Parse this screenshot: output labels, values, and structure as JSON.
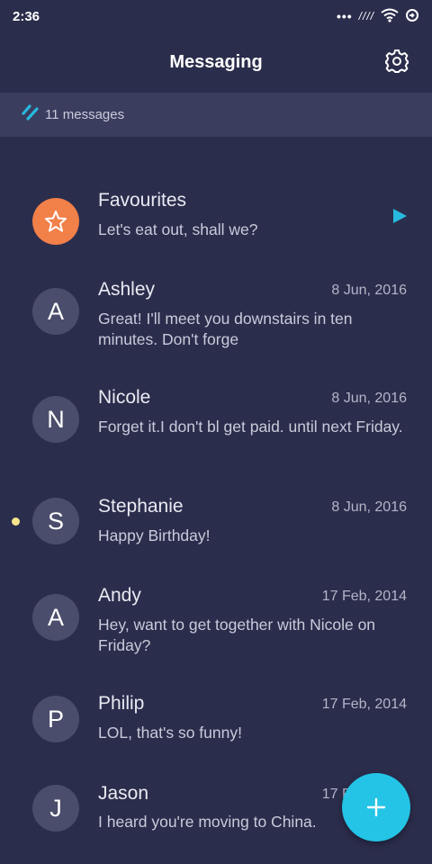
{
  "status_bar": {
    "time": "2:36",
    "dots": "•••",
    "signal": "////",
    "icons": [
      "wifi-icon",
      "sync-icon"
    ]
  },
  "app_bar": {
    "title": "Messaging",
    "settings_icon": "gear-icon"
  },
  "summary": {
    "count_text": "11 messages",
    "icon": "messages-logo-icon"
  },
  "colors": {
    "background": "#2b2d4c",
    "summary_bar": "#3a3d5e",
    "avatar": "#4a4d6b",
    "favourite_avatar": "#f28049",
    "accent": "#23c4e6",
    "unread_dot": "#f6e58d"
  },
  "conversations": [
    {
      "name": "Favourites",
      "date": "",
      "preview": "Let's eat out, shall we?",
      "avatar": "star-icon",
      "favourite": true,
      "unread": false
    },
    {
      "name": "Ashley",
      "date": "8 Jun, 2016",
      "preview": "Great! I'll meet you downstairs in ten minutes. Don't forge",
      "avatar": "A",
      "unread": false
    },
    {
      "name": "Nicole",
      "date": "8 Jun, 2016",
      "preview": "Forget it.I don't bl get paid. until next Friday.",
      "avatar": "N",
      "unread": false
    },
    {
      "name": "Stephanie",
      "date": "8 Jun, 2016",
      "preview": "Happy Birthday!",
      "avatar": "S",
      "unread": true
    },
    {
      "name": "Andy",
      "date": "17 Feb, 2014",
      "preview": "Hey, want to get together with Nicole on Friday?",
      "avatar": "A",
      "unread": false
    },
    {
      "name": "Philip",
      "date": "17 Feb, 2014",
      "preview": "LOL, that's so funny!",
      "avatar": "P",
      "unread": false
    },
    {
      "name": "Jason",
      "date": "17 Feb, 2014",
      "preview": "I heard you're moving to China.",
      "avatar": "J",
      "unread": false
    }
  ],
  "fab": {
    "icon": "plus-icon"
  }
}
